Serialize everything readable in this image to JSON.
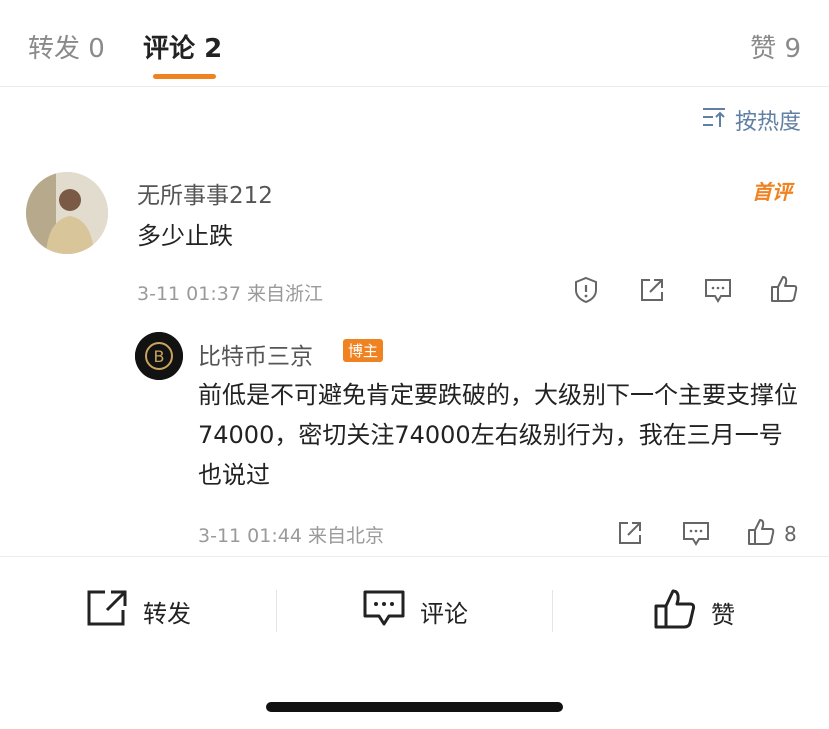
{
  "tabs": {
    "repost": {
      "label": "转发",
      "count": "0"
    },
    "comments": {
      "label": "评论",
      "count": "2"
    },
    "likes": {
      "label": "赞",
      "count": "9"
    }
  },
  "sort": {
    "label": "按热度"
  },
  "comment": {
    "user": "无所事事212",
    "badge": "首评",
    "text": "多少止跌",
    "time": "3-11 01:37",
    "location": "来自浙江"
  },
  "reply": {
    "user": "比特币三京",
    "badge": "博主",
    "text": "前低是不可避免肯定要跌破的，大级别下一个主要支撑位74000，密切关注74000左右级别行为，我在三月一号也说过",
    "time": "3-11 01:44",
    "location": "来自北京",
    "like_count": "8"
  },
  "bottom_bar": {
    "repost_label": "转发",
    "comment_label": "评论",
    "like_label": "赞"
  },
  "colors": {
    "accent": "#f08321",
    "link": "#5f7fa3"
  }
}
